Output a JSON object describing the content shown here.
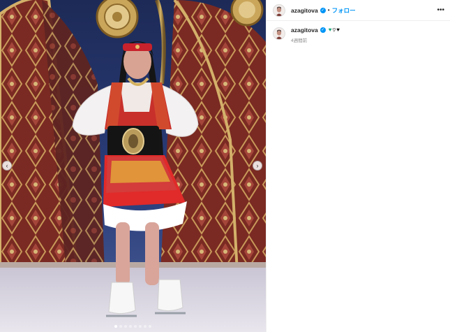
{
  "post": {
    "username": "azagitova",
    "verified": true,
    "follow_label": "フォロー",
    "separator": "•",
    "more_label": "•••",
    "caption_hearts": [
      "green",
      "white",
      "black"
    ],
    "time_ago": "4週間前"
  },
  "carousel": {
    "prev_icon": "chevron-left-icon",
    "next_icon": "chevron-right-icon",
    "prev_glyph": "‹",
    "next_glyph": "›",
    "total_slides": 8,
    "active_slide": 1
  },
  "colors": {
    "follow_blue": "#0095f6",
    "verified_blue": "#0095f6",
    "heart_green": "#1aa57a",
    "muted_text": "#8e8e8e"
  }
}
